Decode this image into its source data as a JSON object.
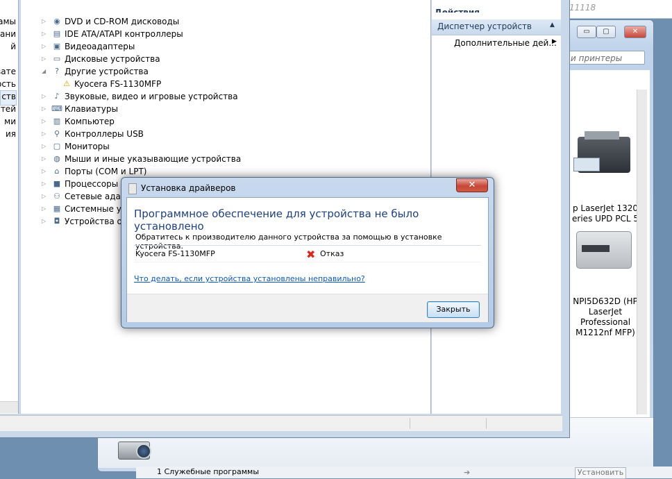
{
  "top_strip": {
    "text": "11118"
  },
  "background_window": {
    "search_placeholder": "и принтеры",
    "printers": [
      {
        "label_lines": [
          "p LaserJet 1320",
          "eries UPD PCL 5"
        ]
      },
      {
        "label_lines": [
          "NPI5D632D (HP",
          "LaserJet",
          "Professional",
          "M1212nf MFP)"
        ]
      }
    ],
    "bottom_label": "1 Служебные программы",
    "bottom_button": "Установить"
  },
  "left_pane": {
    "items": [
      "амы",
      "ани",
      "й",
      "",
      "вате",
      "ость",
      "ств",
      "стей",
      "ми",
      "ия"
    ]
  },
  "device_tree": {
    "nodes": [
      {
        "label": "DVD и CD-ROM дисководы",
        "expanded": false,
        "icon": "disc-drive-icon"
      },
      {
        "label": "IDE ATA/ATAPI контроллеры",
        "expanded": false,
        "icon": "ide-controller-icon"
      },
      {
        "label": "Видеоадаптеры",
        "expanded": false,
        "icon": "display-adapter-icon"
      },
      {
        "label": "Дисковые устройства",
        "expanded": false,
        "icon": "disk-drive-icon"
      },
      {
        "label": "Другие устройства",
        "expanded": true,
        "icon": "other-devices-icon"
      },
      {
        "label": "Kyocera FS-1130MFP",
        "child": true,
        "icon": "warning-device-icon"
      },
      {
        "label": "Звуковые, видео и игровые устройства",
        "expanded": false,
        "icon": "sound-icon"
      },
      {
        "label": "Клавиатуры",
        "expanded": false,
        "icon": "keyboard-icon"
      },
      {
        "label": "Компьютер",
        "expanded": false,
        "icon": "computer-icon"
      },
      {
        "label": "Контроллеры USB",
        "expanded": false,
        "icon": "usb-icon"
      },
      {
        "label": "Мониторы",
        "expanded": false,
        "icon": "monitor-icon"
      },
      {
        "label": "Мыши и иные указывающие устройства",
        "expanded": false,
        "icon": "mouse-icon"
      },
      {
        "label": "Порты (COM и LPT)",
        "expanded": false,
        "icon": "port-icon"
      },
      {
        "label": "Процессоры",
        "expanded": false,
        "icon": "processor-icon"
      },
      {
        "label": "Сетевые адапте",
        "expanded": false,
        "icon": "network-adapter-icon"
      },
      {
        "label": "Системные уст",
        "expanded": false,
        "icon": "system-devices-icon"
      },
      {
        "label": "Устройства обр",
        "expanded": false,
        "icon": "imaging-devices-icon"
      }
    ]
  },
  "actions_pane": {
    "header_partial": "Действия",
    "section_title": "Диспетчер устройств",
    "item": "Дополнительные дей..."
  },
  "dialog": {
    "title": "Установка драйверов",
    "main_instruction": "Программное обеспечение для устройства не было установлено",
    "info": "Обратитесь к производителю данного устройства за помощью в установке устройства.",
    "device_name": "Kyocera FS-1130MFP",
    "status": "Отказ",
    "link": "Что делать, если устройства установлены неправильно?",
    "close_button": "Закрыть",
    "close_glyph": "✕"
  }
}
